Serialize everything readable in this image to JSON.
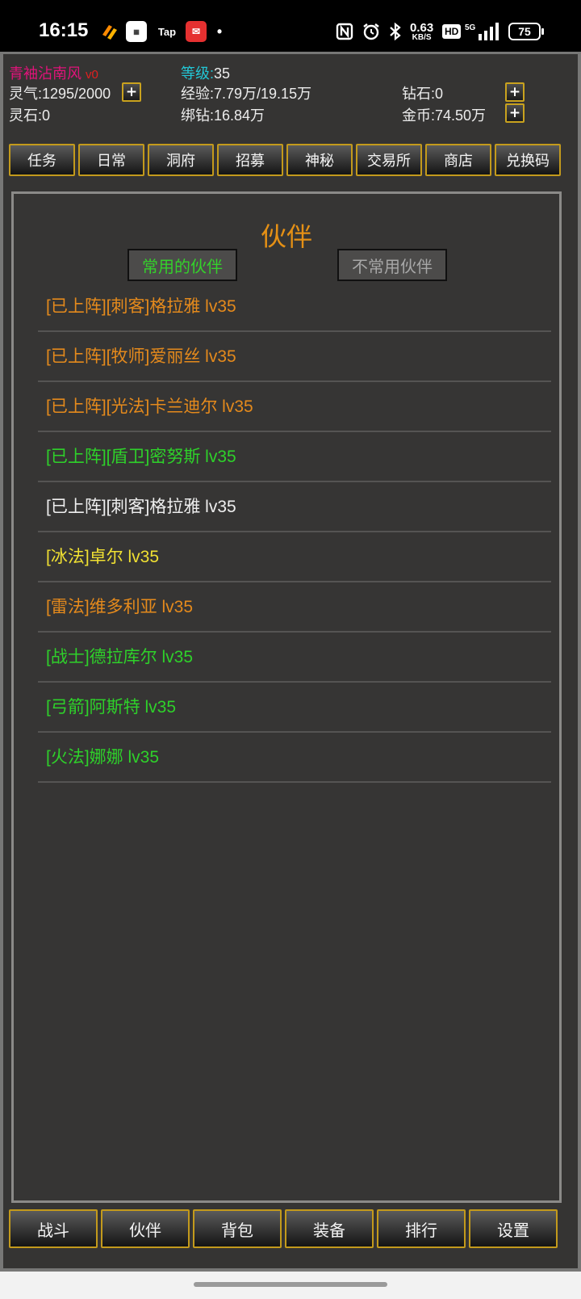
{
  "status_bar": {
    "time": "16:15",
    "apps": [
      "Tap"
    ],
    "net_speed_value": "0.63",
    "net_speed_unit": "KB/S",
    "hd": "HD",
    "signal_label": "5G",
    "battery": "75"
  },
  "player": {
    "name": "青袖沾南风",
    "vip": "v0",
    "level_label": "等级:",
    "level_value": "35",
    "lingqi": "灵气:1295/2000",
    "exp": "经验:7.79万/19.15万",
    "diamond": "钻石:0",
    "lingshi": "灵石:0",
    "bound_diamond": "绑钻:16.84万",
    "gold": "金币:74.50万",
    "plus_label": "+"
  },
  "top_tabs": [
    "任务",
    "日常",
    "洞府",
    "招募",
    "神秘",
    "交易所",
    "商店",
    "兑换码"
  ],
  "panel": {
    "title": "伙伴",
    "toggle_active": "常用的伙伴",
    "toggle_inactive": "不常用伙伴",
    "partners": [
      {
        "text": "[已上阵][刺客]格拉雅 lv35",
        "color": "#e58a1c"
      },
      {
        "text": "[已上阵][牧师]爱丽丝 lv35",
        "color": "#e58a1c"
      },
      {
        "text": "[已上阵][光法]卡兰迪尔 lv35",
        "color": "#e58a1c"
      },
      {
        "text": "[已上阵][盾卫]密努斯 lv35",
        "color": "#2ed12a"
      },
      {
        "text": "[已上阵][刺客]格拉雅 lv35",
        "color": "#efefef"
      },
      {
        "text": "[冰法]卓尔 lv35",
        "color": "#f0e032"
      },
      {
        "text": "[雷法]维多利亚 lv35",
        "color": "#e58a1c"
      },
      {
        "text": "[战士]德拉库尔 lv35",
        "color": "#2ed12a"
      },
      {
        "text": "[弓箭]阿斯特 lv35",
        "color": "#2ed12a"
      },
      {
        "text": "[火法]娜娜 lv35",
        "color": "#2ed12a"
      }
    ]
  },
  "bottom_nav": [
    "战斗",
    "伙伴",
    "背包",
    "装备",
    "排行",
    "设置"
  ],
  "colors": {
    "name": "#e0137a",
    "vip": "#e02020",
    "level_label": "#22c7d6",
    "title": "#e59015",
    "toggle_active": "#34d12b",
    "toggle_inactive": "#a7a7a7",
    "button_border": "#c39a1c"
  }
}
